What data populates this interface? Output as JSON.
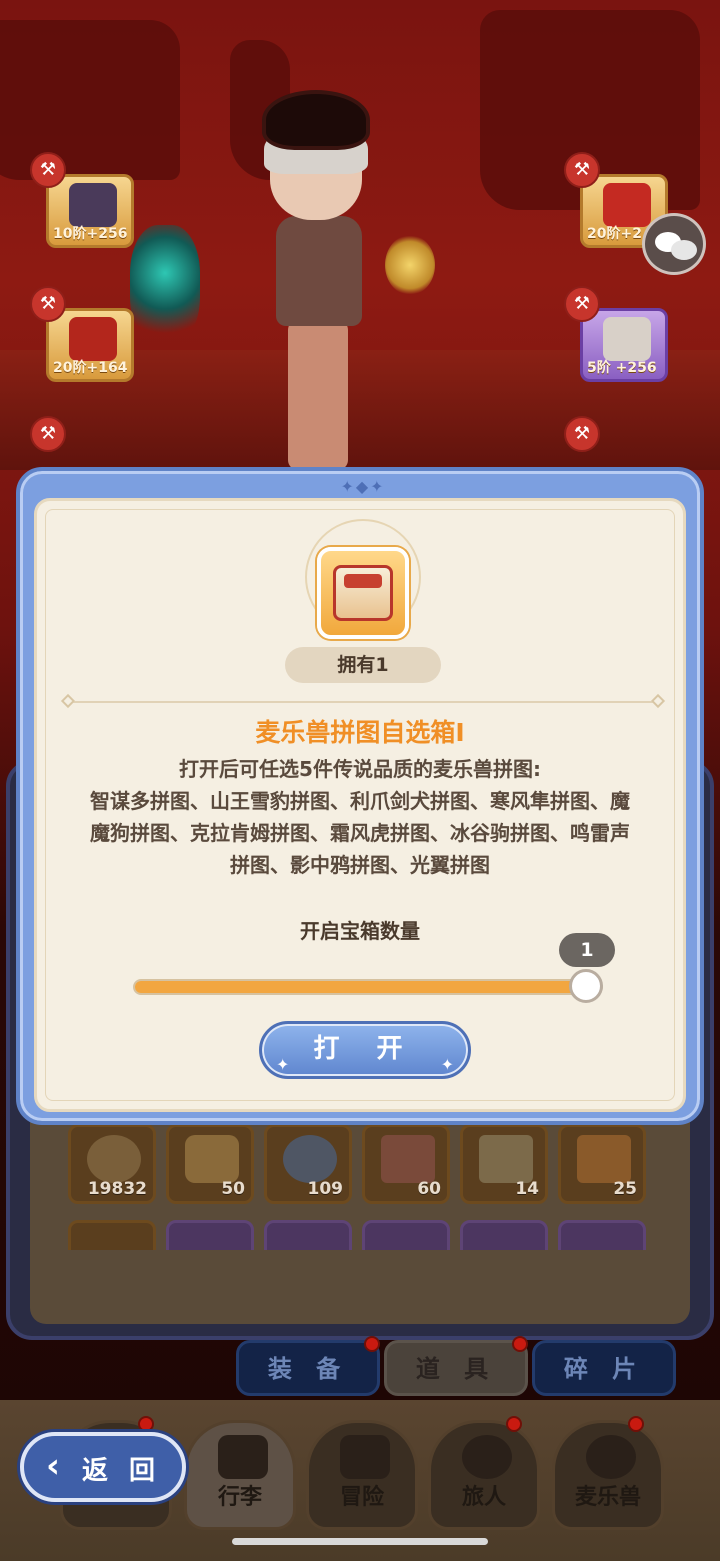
{
  "equipment_slots": [
    {
      "level": "10阶+256",
      "frame": "gold"
    },
    {
      "level": "20阶+164",
      "frame": "gold"
    },
    {
      "level": "20阶+2",
      "frame": "gold"
    },
    {
      "level": "5阶 +256",
      "frame": "purple"
    }
  ],
  "dialog": {
    "owned_label": "拥有1",
    "item_title": "麦乐兽拼图自选箱Ⅰ",
    "item_description": "打开后可任选5件传说品质的麦乐兽拼图:\n智谋多拼图、山王雪豹拼图、利爪剑犬拼图、寒风隼拼图、魔魔狗拼图、克拉肯姆拼图、霜风虎拼图、冰谷驹拼图、鸣雷声拼图、影中鸦拼图、光翼拼图",
    "quantity_label": "开启宝箱数量",
    "quantity_value": "1",
    "quantity_fill_fraction": 1.0,
    "open_button_label": "打 开"
  },
  "inventory": {
    "counts": [
      "19832",
      "50",
      "109",
      "60",
      "14",
      "25"
    ]
  },
  "sub_tabs": [
    "装 备",
    "道 具",
    "碎 片"
  ],
  "bottom_nav": [
    "行李",
    "冒险",
    "旅人",
    "麦乐兽"
  ],
  "back_button_label": "返 回",
  "colors": {
    "accent_orange": "#f08f26",
    "dialog_blue": "#7c9fe0",
    "panel_cream": "#f5efe2"
  }
}
